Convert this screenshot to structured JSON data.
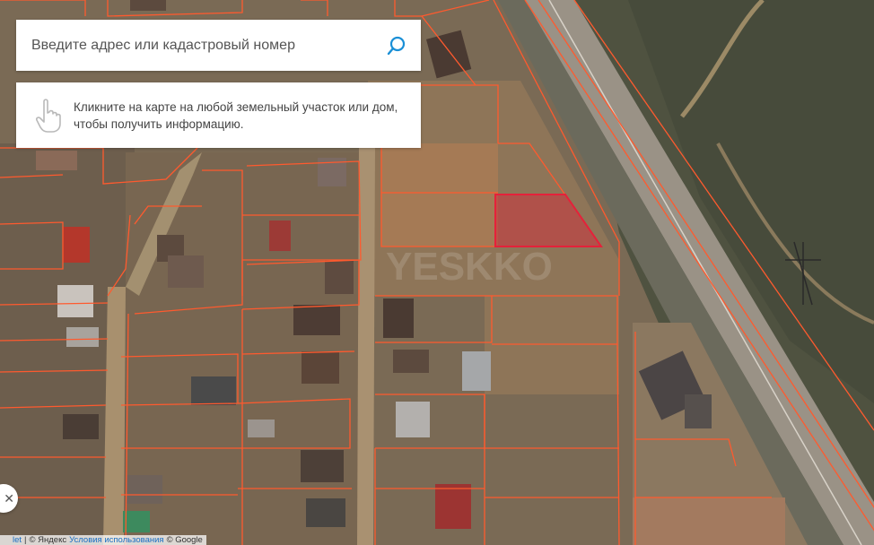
{
  "search": {
    "placeholder": "Введите адрес или кадастровый номер",
    "icon": "search-icon"
  },
  "hint": {
    "icon": "hand-pointer-icon",
    "text": "Кликните на карте на любой земельный участок или дом, чтобы получить информацию."
  },
  "attribution": {
    "leaflet": "let",
    "sep1": "|",
    "yandex": "© Яндекс",
    "terms": "Условия использования",
    "google": "© Google"
  },
  "nav": {
    "arrow_icon": "chevron-left-icon",
    "glyph": "✕"
  },
  "colors": {
    "parcel_border": "#ff5a2e",
    "selected_parcel_fill": "#d9253a",
    "search_accent": "#1a8fd6"
  },
  "map": {
    "watermark": "YESKKO"
  }
}
